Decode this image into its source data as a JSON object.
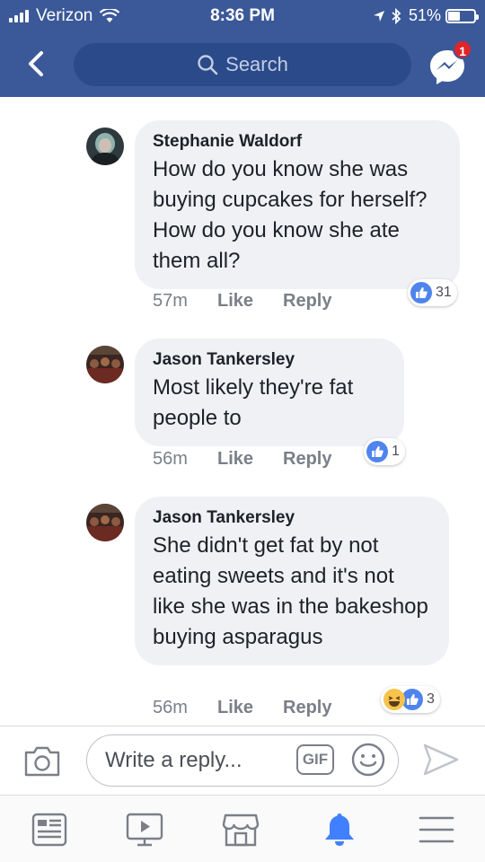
{
  "status_bar": {
    "carrier": "Verizon",
    "time": "8:36 PM",
    "battery_percent": "51%",
    "battery_level": 0.51
  },
  "nav": {
    "search_placeholder": "Search",
    "messenger_badge": "1",
    "icons": [
      "back-arrow-icon",
      "search-icon",
      "messenger-icon"
    ]
  },
  "comments": [
    {
      "author": "Stephanie Waldorf",
      "text": "How do you know she was buying cupcakes for herself? How do you know she ate them all?",
      "time": "57m",
      "like_label": "Like",
      "reply_label": "Reply",
      "reaction_count": "31",
      "reactions": [
        "like"
      ]
    },
    {
      "author": "Jason Tankersley",
      "text": "Most likely they're fat people to",
      "time": "56m",
      "like_label": "Like",
      "reply_label": "Reply",
      "reaction_count": "1",
      "reactions": [
        "like"
      ]
    },
    {
      "author": "Jason Tankersley",
      "text": "She didn't get fat by not eating sweets and it's not like she was in the bakeshop buying asparagus",
      "time": "56m",
      "like_label": "Like",
      "reply_label": "Reply",
      "reaction_count": "3",
      "reactions": [
        "haha",
        "like"
      ]
    }
  ],
  "composer": {
    "placeholder": "Write a reply...",
    "gif_label": "GIF",
    "icons": [
      "camera-icon",
      "gif-icon",
      "smiley-icon",
      "send-icon"
    ]
  },
  "tab_bar": {
    "icons": [
      "news-feed-icon",
      "video-icon",
      "marketplace-icon",
      "notifications-icon",
      "menu-icon"
    ],
    "active": "notifications-icon"
  },
  "colors": {
    "header": "#3b5998",
    "bubble": "#f0f1f4",
    "like_blue": "#4f84ee",
    "active_tab": "#4080ff",
    "badge_red": "#e02427"
  }
}
